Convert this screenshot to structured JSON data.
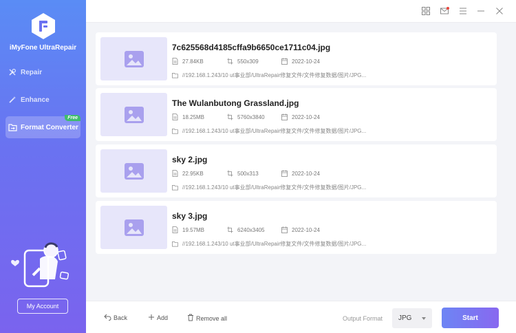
{
  "app": {
    "name": "iMyFone UltraRepair"
  },
  "sidebar": {
    "items": [
      {
        "label": "Repair",
        "icon": "wrench-icon"
      },
      {
        "label": "Enhance",
        "icon": "magic-wand-icon"
      },
      {
        "label": "Format Converter",
        "icon": "folder-convert-icon",
        "badge": "Free",
        "active": true
      }
    ],
    "account_label": "My Account"
  },
  "files": [
    {
      "name": "7c625568d4185cffa9b6650ce1711c04.jpg",
      "size": "27.84KB",
      "dimensions": "550x309",
      "date": "2022-10-24",
      "path": "//192.168.1.243/10 ut事业部/UltraRepair修复文件/文件修复数据/图片/JPG..."
    },
    {
      "name": "The Wulanbutong Grassland.jpg",
      "size": "18.25MB",
      "dimensions": "5760x3840",
      "date": "2022-10-24",
      "path": "//192.168.1.243/10 ut事业部/UltraRepair修复文件/文件修复数据/图片/JPG..."
    },
    {
      "name": "sky 2.jpg",
      "size": "22.95KB",
      "dimensions": "500x313",
      "date": "2022-10-24",
      "path": "//192.168.1.243/10 ut事业部/UltraRepair修复文件/文件修复数据/图片/JPG..."
    },
    {
      "name": "sky 3.jpg",
      "size": "19.57MB",
      "dimensions": "6240x3405",
      "date": "2022-10-24",
      "path": "//192.168.1.243/10 ut事业部/UltraRepair修复文件/文件修复数据/图片/JPG..."
    }
  ],
  "bottom": {
    "back_label": "Back",
    "add_label": "Add",
    "remove_all_label": "Remove all",
    "output_format_label": "Output Format",
    "output_format_value": "JPG",
    "start_label": "Start"
  },
  "colors": {
    "accent": "#7a6cf0",
    "sidebar_top": "#5a8cf5",
    "sidebar_bottom": "#7a63ee",
    "badge": "#3fbd6e",
    "thumb_bg": "#e7e6fa"
  }
}
